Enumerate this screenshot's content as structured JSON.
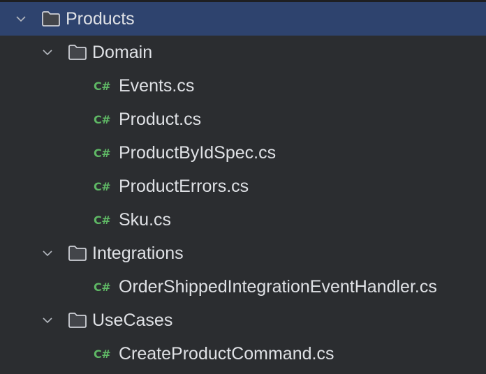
{
  "tree": {
    "root": {
      "label": "Products",
      "icon": "folder-icon",
      "expanded": true,
      "selected": true
    },
    "folders": [
      {
        "label": "Domain",
        "icon": "folder-icon",
        "expanded": true,
        "files": [
          {
            "badge": "C#",
            "label": "Events.cs"
          },
          {
            "badge": "C#",
            "label": "Product.cs"
          },
          {
            "badge": "C#",
            "label": "ProductByIdSpec.cs"
          },
          {
            "badge": "C#",
            "label": "ProductErrors.cs"
          },
          {
            "badge": "C#",
            "label": "Sku.cs"
          }
        ]
      },
      {
        "label": "Integrations",
        "icon": "folder-icon",
        "expanded": true,
        "files": [
          {
            "badge": "C#",
            "label": "OrderShippedIntegrationEventHandler.cs"
          }
        ]
      },
      {
        "label": "UseCases",
        "icon": "folder-icon",
        "expanded": true,
        "files": [
          {
            "badge": "C#",
            "label": "CreateProductCommand.cs"
          }
        ]
      }
    ]
  },
  "colors": {
    "background": "#2b2d30",
    "selection": "#2e436e",
    "text": "#dfe1e5",
    "csharp_badge": "#5fb865"
  }
}
